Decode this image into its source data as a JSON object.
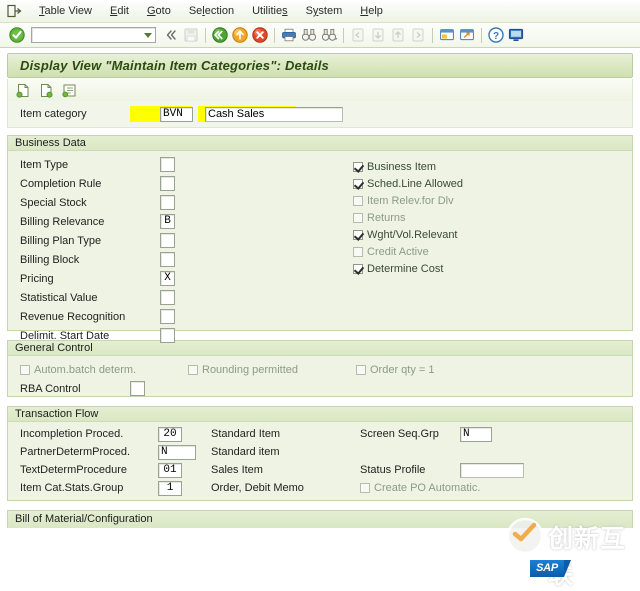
{
  "menu": {
    "exit_icon": "exit-door-icon",
    "items": [
      {
        "label": "Table View",
        "mnemonic": "T"
      },
      {
        "label": "Edit",
        "mnemonic": "E"
      },
      {
        "label": "Goto",
        "mnemonic": "G"
      },
      {
        "label": "Selection",
        "mnemonic": "l"
      },
      {
        "label": "Utilities",
        "mnemonic": "s"
      },
      {
        "label": "System",
        "mnemonic": "y"
      },
      {
        "label": "Help",
        "mnemonic": "H"
      }
    ]
  },
  "toolbar": {
    "enter_icon": "green-check-enter-icon",
    "command_field_value": "",
    "command_field_placeholder": "",
    "dropdown_icon": "chevron-down-icon",
    "icons": [
      {
        "name": "collapse-left-icon",
        "enabled": true
      },
      {
        "name": "save-icon",
        "enabled": false
      },
      {
        "name": "back-green-arrow-icon",
        "enabled": true
      },
      {
        "name": "exit-yellow-arrow-icon",
        "enabled": true
      },
      {
        "name": "cancel-red-x-icon",
        "enabled": true
      },
      {
        "name": "print-icon",
        "enabled": true
      },
      {
        "name": "find-binoculars-icon",
        "enabled": true
      },
      {
        "name": "find-next-binoculars-icon",
        "enabled": true
      },
      {
        "name": "first-page-icon",
        "enabled": false
      },
      {
        "name": "previous-page-icon",
        "enabled": false
      },
      {
        "name": "next-page-icon",
        "enabled": false
      },
      {
        "name": "last-page-icon",
        "enabled": false
      },
      {
        "name": "new-session-icon",
        "enabled": true
      },
      {
        "name": "create-shortcut-icon",
        "enabled": true
      },
      {
        "name": "help-question-icon",
        "enabled": true
      },
      {
        "name": "customize-layout-icon",
        "enabled": true
      }
    ]
  },
  "title_bar": {
    "text": "Display View \"Maintain Item Categories\": Details"
  },
  "app_toolbar": {
    "icons": [
      {
        "name": "display-details-icon"
      },
      {
        "name": "next-entry-icon"
      },
      {
        "name": "other-entry-icon"
      }
    ]
  },
  "header": {
    "item_category_label": "Item category",
    "item_category_key": "BVN",
    "item_category_desc": "Cash Sales"
  },
  "business_data": {
    "title": "Business Data",
    "fields": [
      {
        "label": "Item Type",
        "value": ""
      },
      {
        "label": "Completion Rule",
        "value": ""
      },
      {
        "label": "Special Stock",
        "value": ""
      },
      {
        "label": "Billing Relevance",
        "value": "B"
      },
      {
        "label": "Billing Plan Type",
        "value": ""
      },
      {
        "label": "Billing Block",
        "value": ""
      },
      {
        "label": "Pricing",
        "value": "X"
      },
      {
        "label": "Statistical Value",
        "value": ""
      },
      {
        "label": "Revenue Recognition",
        "value": ""
      },
      {
        "label": "Delimit. Start Date",
        "value": ""
      }
    ],
    "checkboxes": [
      {
        "label": "Business Item",
        "checked": true
      },
      {
        "label": "Sched.Line Allowed",
        "checked": true
      },
      {
        "label": "Item Relev.for Dlv",
        "checked": false
      },
      {
        "label": "Returns",
        "checked": false
      },
      {
        "label": "Wght/Vol.Relevant",
        "checked": true
      },
      {
        "label": "Credit Active",
        "checked": false
      },
      {
        "label": "Determine Cost",
        "checked": true
      }
    ]
  },
  "general_control": {
    "title": "General Control",
    "checkboxes": [
      {
        "label": "Autom.batch determ.",
        "checked": false
      },
      {
        "label": "Rounding permitted",
        "checked": false
      },
      {
        "label": "Order qty = 1",
        "checked": false
      }
    ],
    "rba_label": "RBA Control",
    "rba_value": ""
  },
  "transaction_flow": {
    "title": "Transaction Flow",
    "rows": [
      {
        "label": "Incompletion Proced.",
        "value": "20",
        "desc": "Standard Item"
      },
      {
        "label": "PartnerDetermProced.",
        "value": "N",
        "desc": "Standard item"
      },
      {
        "label": "TextDetermProcedure",
        "value": "01",
        "desc": "Sales Item"
      },
      {
        "label": "Item Cat.Stats.Group",
        "value": "1",
        "desc": "Order, Debit Memo"
      }
    ],
    "screen_seq_label": "Screen Seq.Grp",
    "screen_seq_value": "N",
    "status_profile_label": "Status Profile",
    "status_profile_value": "",
    "create_po_label": "Create PO Automatic.",
    "create_po_checked": false
  },
  "bill_of_material": {
    "title": "Bill of Material/Configuration"
  },
  "watermark": {
    "text": "创新互联",
    "logo_icon": "circle-check-watermark-icon",
    "sap_label": "SAP"
  },
  "colors": {
    "title_bar_green": "#cfe0b0",
    "group_bg": "#eef3e3",
    "highlight_yellow": "#ffff00",
    "accent_green": "#5a7a2e",
    "sap_blue": "#1a7fd4"
  }
}
